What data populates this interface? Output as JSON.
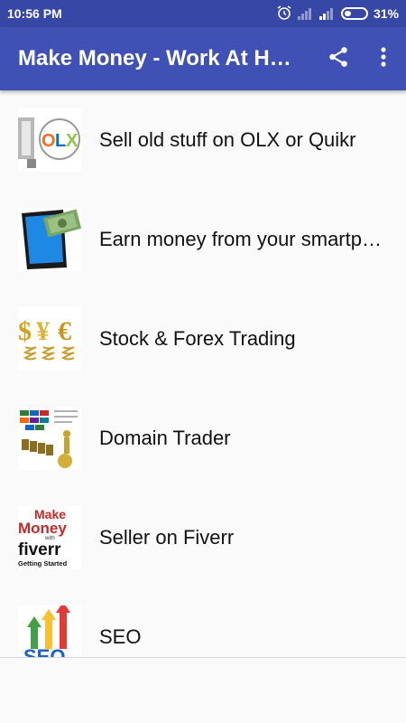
{
  "status_bar": {
    "time": "10:56 PM",
    "battery": "31%",
    "icons": [
      "alarm-icon",
      "signal-weak-icon",
      "signal-icon",
      "battery-icon"
    ]
  },
  "app_bar": {
    "title": "Make Money - Work At Home",
    "icons": [
      "share-icon",
      "more-vert-icon"
    ],
    "color": "#3f51b5"
  },
  "items": [
    {
      "label": "Sell old stuff on OLX or Quikr",
      "thumb": "olx-thumbnail"
    },
    {
      "label": "Earn money from your smartphone",
      "thumb": "smartphone-money-thumbnail"
    },
    {
      "label": "Stock & Forex Trading",
      "thumb": "currency-symbols-thumbnail"
    },
    {
      "label": "Domain Trader",
      "thumb": "domain-thumbnail"
    },
    {
      "label": "Seller on Fiverr",
      "thumb": "fiverr-thumbnail",
      "thumb_text": [
        "Make",
        "Money",
        "with",
        "fiverr",
        "Getting Started"
      ]
    },
    {
      "label": "SEO",
      "thumb": "seo-thumbnail",
      "thumb_text": [
        "SEO"
      ]
    }
  ]
}
